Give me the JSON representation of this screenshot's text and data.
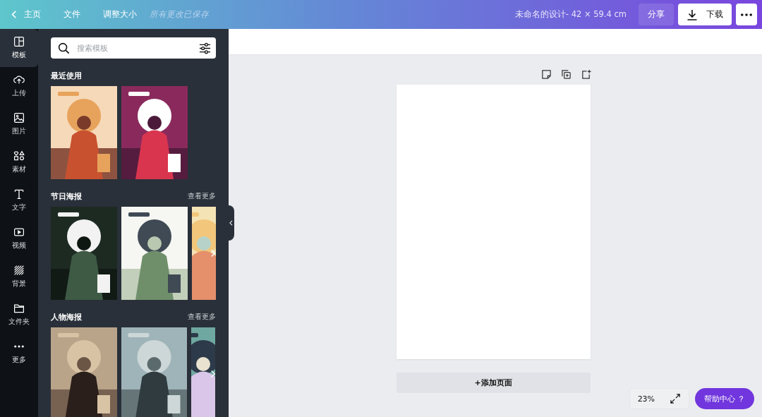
{
  "topbar": {
    "back": "主页",
    "menu": [
      "文件",
      "调整大小"
    ],
    "save_status": "所有更改已保存",
    "design_title": "未命名的设计- 42 × 59.4 cm",
    "share": "分享",
    "download": "下载"
  },
  "sidebar": {
    "items": [
      {
        "label": "模板",
        "selected": true
      },
      {
        "label": "上传",
        "selected": false
      },
      {
        "label": "图片",
        "selected": false
      },
      {
        "label": "素材",
        "selected": false
      },
      {
        "label": "文字",
        "selected": false
      },
      {
        "label": "视频",
        "selected": false
      },
      {
        "label": "背景",
        "selected": false
      },
      {
        "label": "文件夹",
        "selected": false
      },
      {
        "label": "更多",
        "selected": false
      }
    ]
  },
  "panel": {
    "search": {
      "placeholder": "搜索模板"
    },
    "sections": [
      {
        "title": "最近使用"
      },
      {
        "title": "节日海报",
        "more": "查看更多"
      },
      {
        "title": "人物海报",
        "more": "查看更多"
      }
    ]
  },
  "canvas": {
    "add_page": "+添加页面",
    "zoom": "23%",
    "help": "帮助中心 ？"
  }
}
